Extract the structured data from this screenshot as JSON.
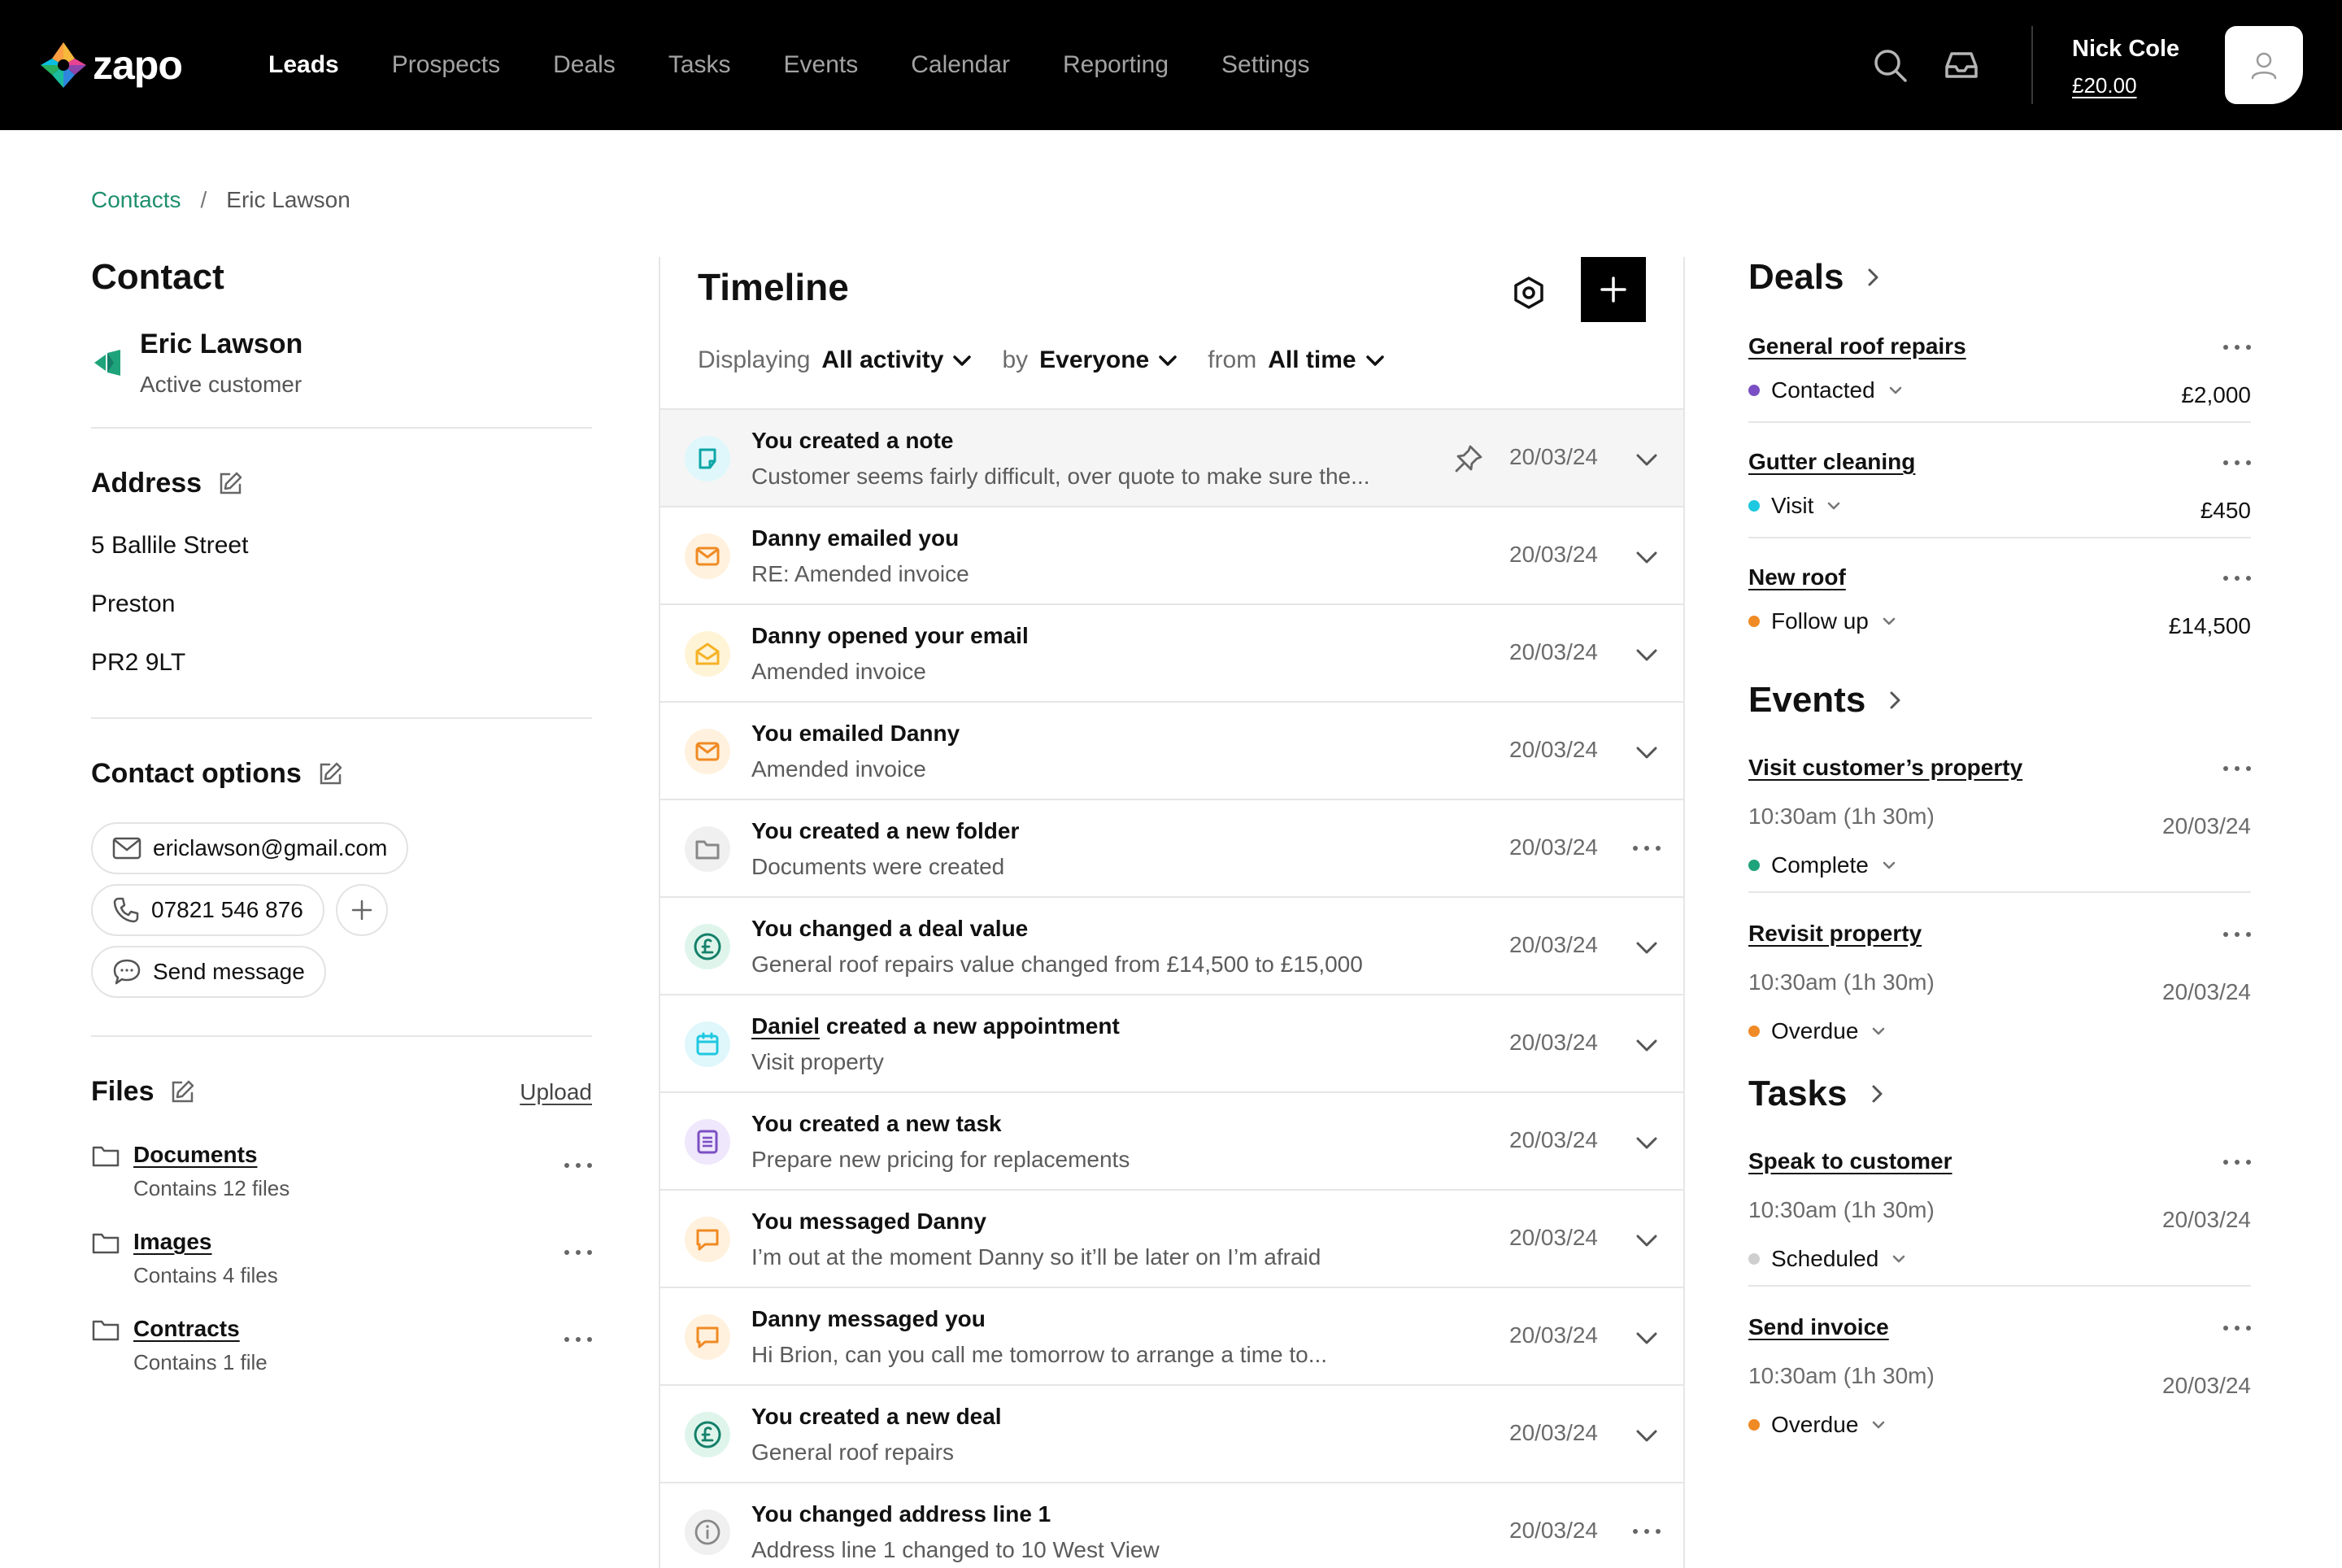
{
  "app": {
    "logo_text": "zapo"
  },
  "nav": {
    "items": [
      {
        "label": "Leads",
        "active": true
      },
      {
        "label": "Prospects"
      },
      {
        "label": "Deals"
      },
      {
        "label": "Tasks"
      },
      {
        "label": "Events"
      },
      {
        "label": "Calendar"
      },
      {
        "label": "Reporting"
      },
      {
        "label": "Settings"
      }
    ]
  },
  "user": {
    "name": "Nick Cole",
    "balance": "£20.00"
  },
  "breadcrumb": {
    "parent": "Contacts",
    "separator": "/",
    "current": "Eric Lawson"
  },
  "contact": {
    "section_title": "Contact",
    "name": "Eric Lawson",
    "status": "Active customer",
    "address_title": "Address",
    "address_lines": [
      "5 Ballile Street",
      "Preston",
      "PR2 9LT"
    ],
    "options_title": "Contact options",
    "email": "ericlawson@gmail.com",
    "phone": "07821 546 876",
    "message_label": "Send message"
  },
  "files": {
    "title": "Files",
    "upload_label": "Upload",
    "items": [
      {
        "name": "Documents",
        "meta": "Contains 12 files"
      },
      {
        "name": "Images",
        "meta": "Contains 4 files"
      },
      {
        "name": "Contracts",
        "meta": "Contains 1 file"
      }
    ]
  },
  "timeline": {
    "title": "Timeline",
    "filters": {
      "displaying_label": "Displaying",
      "displaying_value": "All activity",
      "by_label": "by",
      "by_value": "Everyone",
      "from_label": "from",
      "from_value": "All time"
    },
    "rows": [
      {
        "icon": "note-icon",
        "heading": "You created a note",
        "sub": "Customer seems fairly difficult, over quote to make sure the...",
        "date": "20/03/24",
        "pinned": true,
        "action": "chevron"
      },
      {
        "icon": "mail-icon",
        "heading": "Danny emailed you",
        "sub": "RE: Amended invoice",
        "date": "20/03/24",
        "action": "chevron"
      },
      {
        "icon": "mail-open-icon",
        "heading": "Danny opened your email",
        "sub": "Amended invoice",
        "date": "20/03/24",
        "action": "chevron"
      },
      {
        "icon": "mail-icon",
        "heading": "You emailed Danny",
        "sub": "Amended invoice",
        "date": "20/03/24",
        "action": "chevron"
      },
      {
        "icon": "folder-icon",
        "heading": "You created a new folder",
        "sub": "Documents were created",
        "date": "20/03/24",
        "action": "dots"
      },
      {
        "icon": "pound-icon",
        "heading": "You changed a deal value",
        "sub": "General roof repairs value changed from £14,500 to £15,000",
        "date": "20/03/24",
        "action": "chevron"
      },
      {
        "icon": "calendar-icon",
        "heading_link": "Daniel",
        "heading": "created a new appointment",
        "sub": "Visit property",
        "date": "20/03/24",
        "action": "chevron"
      },
      {
        "icon": "task-icon",
        "heading": "You created a new task",
        "sub": "Prepare new pricing for replacements",
        "date": "20/03/24",
        "action": "chevron"
      },
      {
        "icon": "chat-icon",
        "heading": "You messaged Danny",
        "sub": "I’m out at the moment Danny so it’ll be later on I’m afraid",
        "date": "20/03/24",
        "action": "chevron"
      },
      {
        "icon": "chat-icon",
        "heading": "Danny messaged you",
        "sub": "Hi Brion, can you call me tomorrow to arrange a time to...",
        "date": "20/03/24",
        "action": "chevron"
      },
      {
        "icon": "pound-icon",
        "heading": "You created a new deal",
        "sub": "General roof repairs",
        "date": "20/03/24",
        "action": "chevron"
      },
      {
        "icon": "info-icon",
        "heading": "You changed address line 1",
        "sub": "Address line 1 changed to 10 West View",
        "date": "20/03/24",
        "action": "dots"
      }
    ]
  },
  "deals": {
    "title": "Deals",
    "items": [
      {
        "name": "General roof repairs",
        "status": "Contacted",
        "status_color": "#7b4fc4",
        "value": "£2,000"
      },
      {
        "name": "Gutter cleaning",
        "status": "Visit",
        "status_color": "#1ec8e0",
        "value": "£450"
      },
      {
        "name": "New roof",
        "status": "Follow up",
        "status_color": "#f08a24",
        "value": "£14,500"
      }
    ]
  },
  "events": {
    "title": "Events",
    "items": [
      {
        "name": "Visit customer’s property",
        "time": "10:30am (1h 30m)",
        "date": "20/03/24",
        "status": "Complete",
        "status_color": "#1fa37a"
      },
      {
        "name": "Revisit property",
        "time": "10:30am (1h 30m)",
        "date": "20/03/24",
        "status": "Overdue",
        "status_color": "#f08a24"
      }
    ]
  },
  "tasks": {
    "title": "Tasks",
    "items": [
      {
        "name": "Speak to customer",
        "time": "10:30am (1h 30m)",
        "date": "20/03/24",
        "status": "Scheduled",
        "status_color": "#cfcfcf"
      },
      {
        "name": "Send invoice",
        "time": "10:30am (1h 30m)",
        "date": "20/03/24",
        "status": "Overdue",
        "status_color": "#f08a24"
      }
    ]
  }
}
